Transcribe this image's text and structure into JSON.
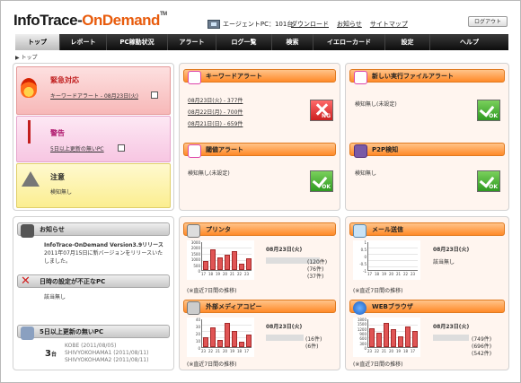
{
  "header": {
    "logo_part1": "InfoTrace-",
    "logo_part2": "OnDemand",
    "logo_tm": "TM",
    "agent_text": "エージェントPC：101台",
    "links": [
      "ダウンロード",
      "お知らせ",
      "サイトマップ"
    ],
    "logout": "ログアウト"
  },
  "nav": [
    "トップ",
    "レポート",
    "PC稼動状況",
    "アラート",
    "ログ一覧",
    "検索",
    "イエローカード",
    "設定",
    "ヘルプ"
  ],
  "breadcrumb": "▶ トップ",
  "emergency": {
    "title": "緊急対応",
    "link": "キーワードアラート - 08月23日(火)"
  },
  "warning": {
    "title": "警告",
    "link": "5日以上更新の無いPC"
  },
  "notice": {
    "title": "注意",
    "text": "検知無し"
  },
  "keyword_alert": {
    "title": "キーワードアラート",
    "rows": [
      "08月23日(火) - 377件",
      "08月22日(月) - 700件",
      "08月21日(日) - 659件"
    ],
    "status": "NG"
  },
  "threshold_alert": {
    "title": "閾値アラート",
    "text": "検知無し(未設定)",
    "status": "OK"
  },
  "new_exec": {
    "title": "新しい実行ファイルアラート",
    "text": "検知無し(未設定)",
    "status": "OK"
  },
  "p2p": {
    "title": "P2P検知",
    "text": "検知無し",
    "status": "OK"
  },
  "news": {
    "title": "お知らせ",
    "head": "InfoTrace-OnDemand Version3.9リリース",
    "body1": "2011年07月15日に新バージョンをリリースいた",
    "body2": "しました。"
  },
  "time_incorrect": {
    "title": "日時の設定が不正なPC",
    "text": "該当無し"
  },
  "no_update": {
    "title": "5日以上更新の無いPC",
    "count": "3",
    "unit": "台",
    "rows": [
      "KOBE (2011/08/05)",
      "SHIVYOKOHAMA1 (2011/08/11)",
      "SHIVYOKOHAMA2 (2011/08/11)"
    ]
  },
  "printer": {
    "title": "プリンタ",
    "date": "08月23日(火)",
    "lines": [
      "(120件)",
      "(76件)",
      "(37件)"
    ],
    "note": "(※直近7日間の推移)",
    "yticks": [
      "3000",
      "2000",
      "1500",
      "1000",
      "500",
      "0"
    ],
    "xticks": [
      "17",
      "18",
      "19",
      "20",
      "21",
      "22",
      "23"
    ],
    "values": [
      900,
      2200,
      1300,
      1600,
      2000,
      700,
      1200
    ]
  },
  "mail": {
    "title": "メール送信",
    "date": "08月23日(火)",
    "text": "該当無し",
    "note": "(※直近7日間の推移)",
    "yticks": [
      "1",
      "0.5",
      "0",
      "-0.5",
      "-1"
    ],
    "xticks": [
      "17",
      "18",
      "19",
      "20",
      "21",
      "22",
      "23"
    ],
    "values": [
      0,
      0,
      0,
      0,
      0,
      0,
      0
    ]
  },
  "external_media": {
    "title": "外部メディアコピー",
    "date": "08月23日(火)",
    "lines": [
      "(16件)",
      "(6件)"
    ],
    "note": "(※直近7日間の推移)",
    "yticks": [
      "40",
      "30",
      "20",
      "10",
      "0"
    ],
    "xticks": [
      "23",
      "22",
      "21",
      "20",
      "19",
      "18",
      "17"
    ],
    "values": [
      14,
      28,
      10,
      34,
      22,
      8,
      18
    ]
  },
  "web": {
    "title": "WEBブラウザ",
    "date": "08月23日(火)",
    "lines": [
      "(749件)",
      "(696件)",
      "(542件)"
    ],
    "note": "(※直近7日間の推移)",
    "yticks": [
      "1800",
      "1500",
      "1200",
      "900",
      "600",
      "300",
      "0"
    ],
    "xticks": [
      "23",
      "22",
      "21",
      "20",
      "19",
      "18",
      "17"
    ],
    "values": [
      1200,
      900,
      1500,
      1100,
      700,
      1300,
      1000
    ]
  },
  "colors": {
    "accent": "#e85c0d",
    "red_card": "#fbcbcb",
    "pink_card": "#fbd8ec",
    "yellow_card": "#fdf3a8",
    "ok": "#3aa52a",
    "ng": "#d32a2a"
  }
}
